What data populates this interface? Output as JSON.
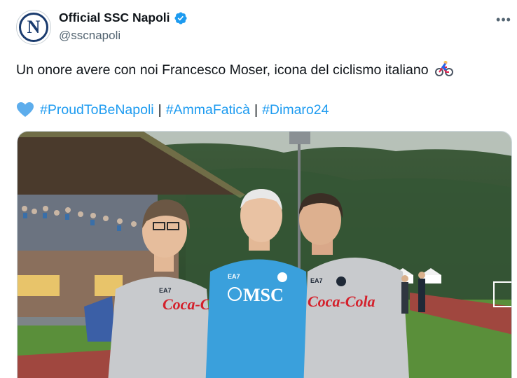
{
  "account": {
    "display_name": "Official SSC Napoli",
    "handle": "@sscnapoli",
    "avatar_letter": "N",
    "verified": true
  },
  "menu": {
    "more_label": "•••"
  },
  "tweet": {
    "text": "Un onore avere con noi Francesco Moser, icona del ciclismo italiano",
    "emoji_icon": "person-biking-icon",
    "heart_icon": "light-blue-heart-icon",
    "hashtags": [
      "#ProudToBeNapoli",
      "#AmmaFaticà",
      "#Dimaro24"
    ],
    "separator": "|"
  },
  "media": {
    "description_icon": "photo",
    "shirt_texts": {
      "left": "Coca-Cola",
      "center": "MSC",
      "right": "Coca-Cola",
      "brand": "EA7"
    }
  },
  "colors": {
    "link": "#1d9bf0",
    "verified": "#1d9bf0",
    "text": "#0f1419",
    "muted": "#536471",
    "napoli_blue": "#1a3b6e",
    "shirt_blue": "#3aa0dc"
  }
}
